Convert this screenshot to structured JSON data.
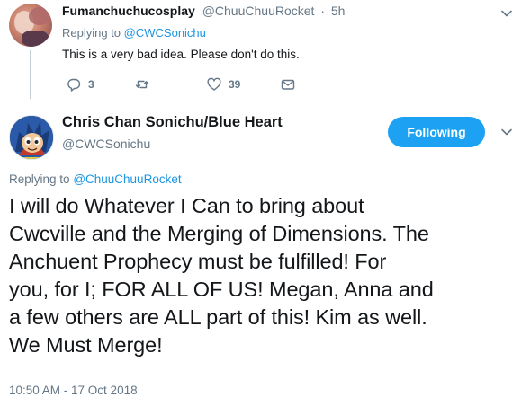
{
  "reply_tweet": {
    "display_name": "Fumanchuchucosplay",
    "handle": "@ChuuChuuRocket",
    "separator": "·",
    "time": "5h",
    "replying_to_prefix": "Replying to",
    "replying_to_handle": "@CWCSonichu",
    "text": "This is a very bad idea. Please don't do this.",
    "reply_count": "3",
    "retweet_count": "",
    "like_count": "39"
  },
  "main_tweet": {
    "display_name": "Chris Chan Sonichu/Blue Heart",
    "handle": "@CWCSonichu",
    "follow_label": "Following",
    "replying_to_prefix": "Replying to",
    "replying_to_handle": "@ChuuChuuRocket",
    "text_lines": [
      "I will do Whatever I Can to bring about",
      "Cwcville and the Merging of Dimensions. The",
      "Anchuent Prophecy must be fulfilled! For",
      "you, for I; FOR ALL OF US! Megan, Anna and",
      "a few others are ALL part of this! Kim as well.",
      "We Must Merge!"
    ],
    "timestamp": "10:50 AM - 17 Oct 2018"
  },
  "icons": {
    "reply": "reply-icon",
    "retweet": "retweet-icon",
    "like": "heart-icon",
    "dm": "envelope-icon",
    "more": "chevron-down-icon"
  },
  "colors": {
    "accent": "#1da1f2",
    "link": "#1b95e0",
    "secondary_text": "#657786",
    "primary_text": "#14171a"
  }
}
